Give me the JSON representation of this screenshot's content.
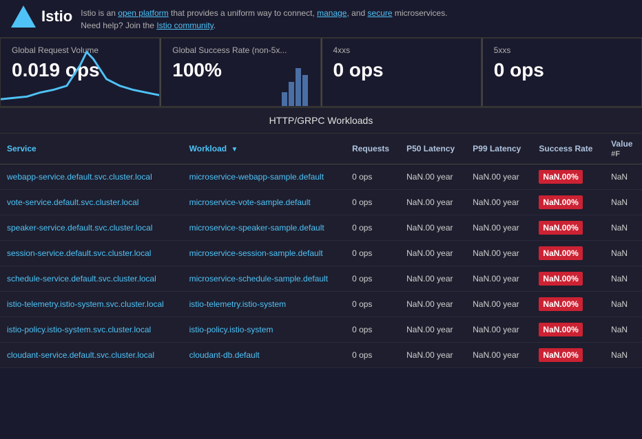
{
  "header": {
    "logo_text": "Istio",
    "description": "Istio is an open platform that provides a uniform way to connect, manage, and secure microservices. Need help? Join the Istio community.",
    "links": {
      "open_platform": "open platform",
      "manage": "manage",
      "secure": "secure",
      "community": "Istio community"
    }
  },
  "metrics": [
    {
      "label": "Global Request Volume",
      "value": "0.019 ops",
      "has_sparkline": true
    },
    {
      "label": "Global Success Rate (non-5x...",
      "value": "100%",
      "has_bar": true
    },
    {
      "label": "4xxs",
      "value": "0 ops",
      "has_sparkline": false
    },
    {
      "label": "5xxs",
      "value": "0 ops",
      "has_sparkline": false
    }
  ],
  "table": {
    "title": "HTTP/GRPC Workloads",
    "columns": [
      {
        "id": "service",
        "label": "Service",
        "sortable": false
      },
      {
        "id": "workload",
        "label": "Workload",
        "sortable": true
      },
      {
        "id": "requests",
        "label": "Requests",
        "sortable": false
      },
      {
        "id": "p50",
        "label": "P50 Latency",
        "sortable": false
      },
      {
        "id": "p99",
        "label": "P99 Latency",
        "sortable": false
      },
      {
        "id": "success",
        "label": "Success Rate",
        "sortable": false
      },
      {
        "id": "value",
        "label": "Value\n#F",
        "sortable": false
      }
    ],
    "rows": [
      {
        "service": "webapp-service.default.svc.cluster.local",
        "workload": "microservice-webapp-sample.default",
        "requests": "0 ops",
        "p50": "NaN.00 year",
        "p99": "NaN.00 year",
        "success": "NaN.00%",
        "value": "NaN"
      },
      {
        "service": "vote-service.default.svc.cluster.local",
        "workload": "microservice-vote-sample.default",
        "requests": "0 ops",
        "p50": "NaN.00 year",
        "p99": "NaN.00 year",
        "success": "NaN.00%",
        "value": "NaN"
      },
      {
        "service": "speaker-service.default.svc.cluster.local",
        "workload": "microservice-speaker-sample.default",
        "requests": "0 ops",
        "p50": "NaN.00 year",
        "p99": "NaN.00 year",
        "success": "NaN.00%",
        "value": "NaN"
      },
      {
        "service": "session-service.default.svc.cluster.local",
        "workload": "microservice-session-sample.default",
        "requests": "0 ops",
        "p50": "NaN.00 year",
        "p99": "NaN.00 year",
        "success": "NaN.00%",
        "value": "NaN"
      },
      {
        "service": "schedule-service.default.svc.cluster.local",
        "workload": "microservice-schedule-sample.default",
        "requests": "0 ops",
        "p50": "NaN.00 year",
        "p99": "NaN.00 year",
        "success": "NaN.00%",
        "value": "NaN"
      },
      {
        "service": "istio-telemetry.istio-system.svc.cluster.local",
        "workload": "istio-telemetry.istio-system",
        "requests": "0 ops",
        "p50": "NaN.00 year",
        "p99": "NaN.00 year",
        "success": "NaN.00%",
        "value": "NaN"
      },
      {
        "service": "istio-policy.istio-system.svc.cluster.local",
        "workload": "istio-policy.istio-system",
        "requests": "0 ops",
        "p50": "NaN.00 year",
        "p99": "NaN.00 year",
        "success": "NaN.00%",
        "value": "NaN"
      },
      {
        "service": "cloudant-service.default.svc.cluster.local",
        "workload": "cloudant-db.default",
        "requests": "0 ops",
        "p50": "NaN.00 year",
        "p99": "NaN.00 year",
        "success": "NaN.00%",
        "value": "NaN"
      }
    ]
  }
}
